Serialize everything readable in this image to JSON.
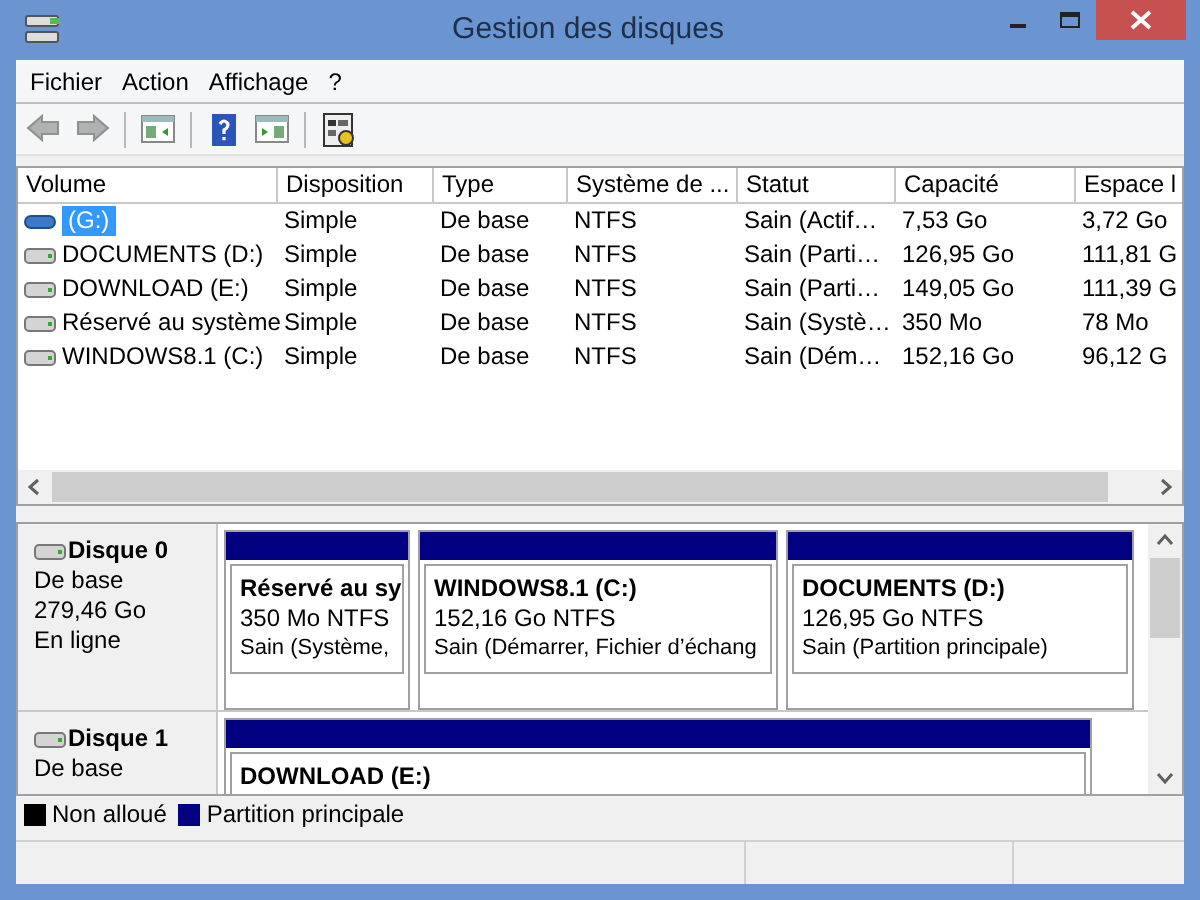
{
  "window": {
    "title": "Gestion des disques"
  },
  "menu": [
    {
      "label": "Fichier"
    },
    {
      "label": "Action"
    },
    {
      "label": "Affichage"
    },
    {
      "label": "?"
    }
  ],
  "toolbar": [
    {
      "kind": "back",
      "disabled": true
    },
    {
      "kind": "forward",
      "disabled": true
    },
    {
      "kind": "sep"
    },
    {
      "kind": "tree",
      "disabled": false
    },
    {
      "kind": "sep"
    },
    {
      "kind": "help",
      "disabled": false
    },
    {
      "kind": "pane",
      "disabled": false
    },
    {
      "kind": "sep"
    },
    {
      "kind": "props",
      "disabled": false
    }
  ],
  "table": {
    "columns": [
      "Volume",
      "Disposition",
      "Type",
      "Système de ...",
      "Statut",
      "Capacité",
      "Espace l"
    ],
    "rows": [
      {
        "kind": "removable",
        "selected": true,
        "cells": [
          "(G:)",
          "Simple",
          "De base",
          "NTFS",
          "Sain (Actif…",
          "7,53 Go",
          "3,72 Go"
        ]
      },
      {
        "kind": "disk",
        "selected": false,
        "cells": [
          "DOCUMENTS (D:)",
          "Simple",
          "De base",
          "NTFS",
          "Sain (Parti…",
          "126,95 Go",
          "111,81 G"
        ]
      },
      {
        "kind": "disk",
        "selected": false,
        "cells": [
          "DOWNLOAD (E:)",
          "Simple",
          "De base",
          "NTFS",
          "Sain (Parti…",
          "149,05 Go",
          "111,39 G"
        ]
      },
      {
        "kind": "disk",
        "selected": false,
        "cells": [
          "Réservé au système",
          "Simple",
          "De base",
          "NTFS",
          "Sain (Systè…",
          "350 Mo",
          "78 Mo"
        ]
      },
      {
        "kind": "disk",
        "selected": false,
        "cells": [
          "WINDOWS8.1 (C:)",
          "Simple",
          "De base",
          "NTFS",
          "Sain (Dém…",
          "152,16 Go",
          "96,12 G"
        ]
      }
    ]
  },
  "disks": [
    {
      "name": "Disque 0",
      "lines": [
        "De base",
        "279,46 Go",
        "En ligne"
      ],
      "partitions": [
        {
          "name": "Réservé au sy",
          "size": "350 Mo NTFS",
          "status": "Sain (Système,"
        },
        {
          "name": "WINDOWS8.1  (C:)",
          "size": "152,16 Go NTFS",
          "status": "Sain (Démarrer, Fichier d’échang"
        },
        {
          "name": "DOCUMENTS  (D:)",
          "size": "126,95 Go NTFS",
          "status": "Sain (Partition principale)"
        }
      ]
    },
    {
      "name": "Disque 1",
      "lines": [
        "De base"
      ],
      "partitions": [
        {
          "name": "DOWNLOAD  (E:)"
        }
      ]
    }
  ],
  "legend": [
    {
      "label": "Non alloué",
      "color": "#000000"
    },
    {
      "label": "Partition principale",
      "color": "#000080"
    }
  ]
}
